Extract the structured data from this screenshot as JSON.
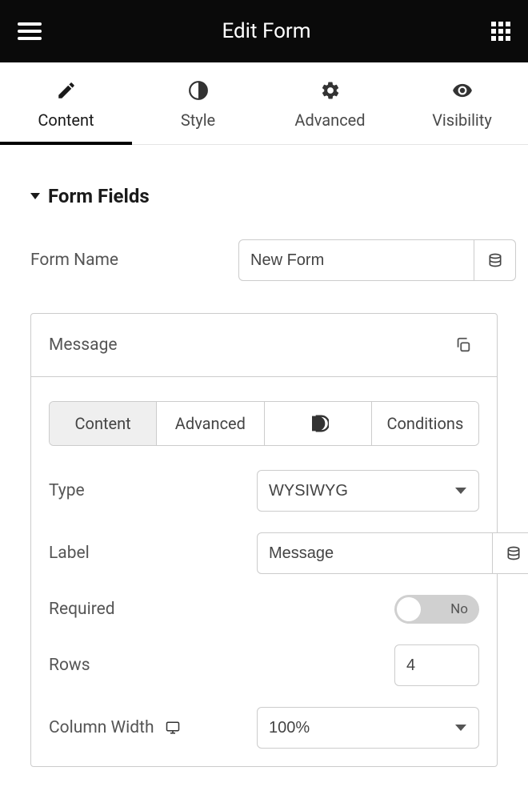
{
  "header": {
    "title": "Edit Form"
  },
  "tabs": {
    "content": "Content",
    "style": "Style",
    "advanced": "Advanced",
    "visibility": "Visibility"
  },
  "section": {
    "title": "Form Fields"
  },
  "formName": {
    "label": "Form Name",
    "value": "New Form"
  },
  "field": {
    "title": "Message",
    "subtabs": {
      "content": "Content",
      "advanced": "Advanced",
      "conditions": "Conditions"
    },
    "type": {
      "label": "Type",
      "value": "WYSIWYG"
    },
    "labelRow": {
      "label": "Label",
      "value": "Message"
    },
    "required": {
      "label": "Required",
      "value": "No"
    },
    "rows": {
      "label": "Rows",
      "value": "4"
    },
    "columnWidth": {
      "label": "Column Width",
      "value": "100%"
    }
  }
}
